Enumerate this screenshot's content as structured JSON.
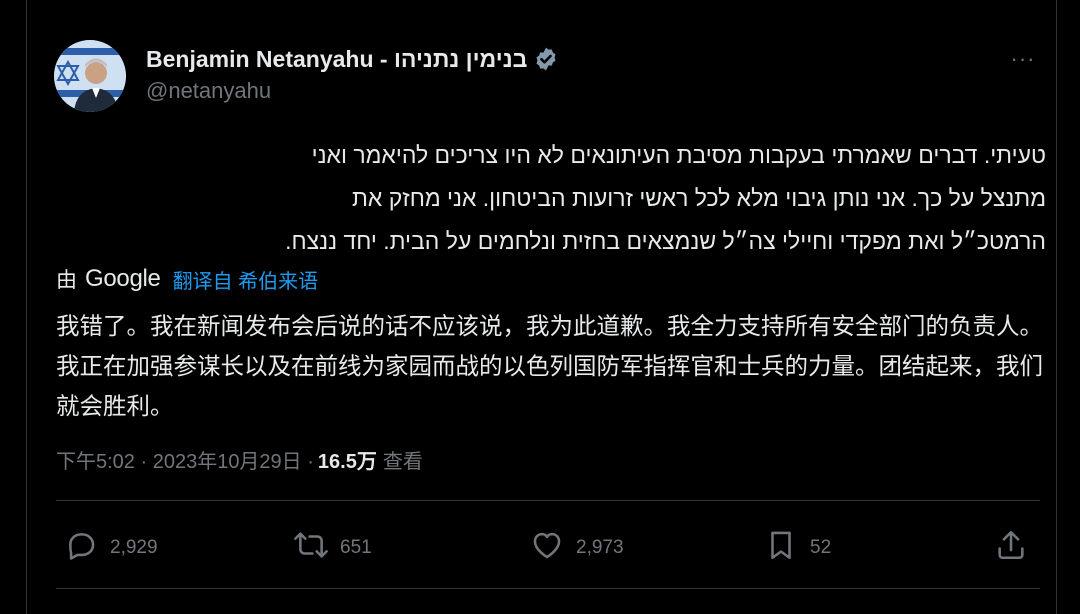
{
  "tweet": {
    "display_name": "Benjamin Netanyahu - בנימין נתניהו",
    "handle": "@netanyahu",
    "more_label": "···",
    "text_hebrew_lines": [
      "טעיתי. דברים שאמרתי בעקבות מסיבת העיתונאים לא היו צריכים להיאמר ואני",
      "מתנצל על כך. אני נותן גיבוי מלא לכל ראשי זרועות הביטחון. אני מחזק את",
      "הרמטכ״ל ואת מפקדי וחיילי צה״ל שנמצאים בחזית ונלחמים על הבית. יחד ננצח."
    ],
    "translation": {
      "by": "由",
      "provider": "Google",
      "link": "翻译自 希伯来语"
    },
    "text_chinese": "我错了。我在新闻发布会后说的话不应该说，我为此道歉。我全力支持所有安全部门的负责人。我正在加强参谋长以及在前线为家园而战的以色列国防军指挥官和士兵的力量。团结起来，我们就会胜利。",
    "time": "下午5:02 · 2023年10月29日 ·",
    "views_count": "16.5万",
    "views_label": "查看",
    "actions": {
      "replies": "2,929",
      "reposts": "651",
      "likes": "2,973",
      "bookmarks": "52"
    },
    "icons": {
      "verified": "verified-badge-icon",
      "reply": "reply-icon",
      "repost": "repost-icon",
      "like": "heart-icon",
      "bookmark": "bookmark-icon",
      "share": "share-icon"
    }
  }
}
